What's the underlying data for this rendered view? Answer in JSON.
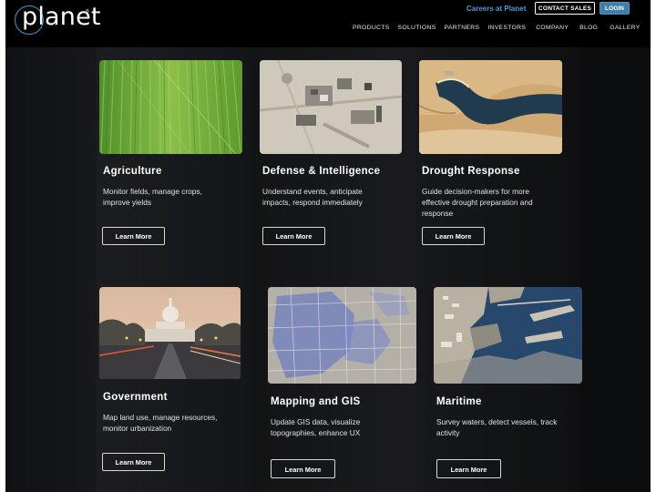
{
  "header": {
    "logo_text": "planet",
    "logo_mark": "®",
    "careers_link": "Careers at Planet",
    "contact_button": "CONTACT SALES",
    "login_button": "LOGIN",
    "nav": [
      "PRODUCTS",
      "SOLUTIONS",
      "PARTNERS",
      "INVESTORS",
      "COMPANY",
      "BLOG",
      "GALLERY"
    ]
  },
  "colors": {
    "accent": "#4f9bd6",
    "login_bg": "#3f7ea6",
    "page_bg": "#0d0e10"
  },
  "solutions": [
    {
      "title": "Agriculture",
      "desc": [
        "Monitor fields, manage crops,",
        "improve yields"
      ],
      "button": "Learn More",
      "image": "green-crop-field-aerial"
    },
    {
      "title": "Defense & Intelligence",
      "desc": [
        "Understand events, anticipate",
        "impacts, respond immediately"
      ],
      "button": "Learn More",
      "image": "desert-facility-aerial"
    },
    {
      "title": "Drought Response",
      "desc": [
        "Guide decision-makers for more",
        "effective drought preparation and",
        "response"
      ],
      "button": "Learn More",
      "image": "river-canyon-aerial"
    },
    {
      "title": "Government",
      "desc": [
        "Map land use, manage resources,",
        "monitor urbanization"
      ],
      "button": "Learn More",
      "image": "capitol-building-photo"
    },
    {
      "title": "Mapping and GIS",
      "desc": [
        "Update GIS data, visualize",
        "topographies, enhance UX"
      ],
      "button": "Learn More",
      "image": "city-map-overlay-aerial"
    },
    {
      "title": "Maritime",
      "desc": [
        "Survey waters, detect vessels, track",
        "activity"
      ],
      "button": "Learn More",
      "image": "harbor-port-aerial"
    }
  ]
}
